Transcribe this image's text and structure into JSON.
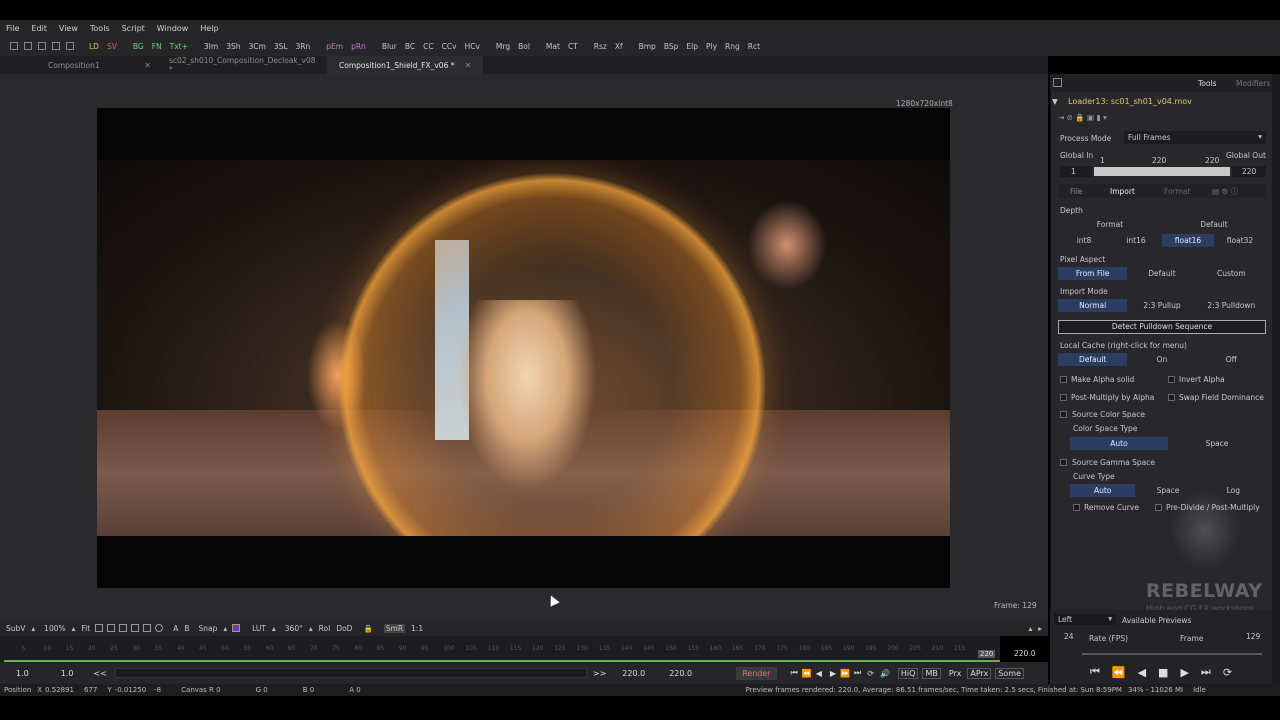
{
  "menu": [
    "File",
    "Edit",
    "View",
    "Tools",
    "Script",
    "Window",
    "Help"
  ],
  "toolbar": {
    "items": [
      {
        "label": "LD",
        "color": "yel"
      },
      {
        "label": "SV",
        "color": "red"
      },
      {
        "label": "BG",
        "color": "grn"
      },
      {
        "label": "FN",
        "color": "grn"
      },
      {
        "label": "Txt+",
        "color": "grn"
      },
      {
        "label": "3Im",
        "color": ""
      },
      {
        "label": "3Sh",
        "color": ""
      },
      {
        "label": "3Cm",
        "color": ""
      },
      {
        "label": "3SL",
        "color": ""
      },
      {
        "label": "3Rn",
        "color": ""
      },
      {
        "label": "pEm",
        "color": "pink"
      },
      {
        "label": "pRn",
        "color": "pink"
      },
      {
        "label": "Blur",
        "color": ""
      },
      {
        "label": "BC",
        "color": ""
      },
      {
        "label": "CC",
        "color": ""
      },
      {
        "label": "CCv",
        "color": ""
      },
      {
        "label": "HCv",
        "color": ""
      },
      {
        "label": "Mrg",
        "color": ""
      },
      {
        "label": "Bol",
        "color": ""
      },
      {
        "label": "Mat",
        "color": ""
      },
      {
        "label": "CT",
        "color": ""
      },
      {
        "label": "Rsz",
        "color": ""
      },
      {
        "label": "Xf",
        "color": ""
      },
      {
        "label": "Bmp",
        "color": ""
      },
      {
        "label": "BSp",
        "color": ""
      },
      {
        "label": "Elp",
        "color": ""
      },
      {
        "label": "Ply",
        "color": ""
      },
      {
        "label": "Rng",
        "color": ""
      },
      {
        "label": "Rct",
        "color": ""
      }
    ]
  },
  "tabs": [
    {
      "label": "Composition1",
      "active": false
    },
    {
      "label": "sc02_sh010_Composition_Decloak_v08 *",
      "active": false
    },
    {
      "label": "Composition1_Shield_FX_v06 *",
      "active": true
    }
  ],
  "viewer": {
    "resolution": "1280x720xint8",
    "frame_info": "Frame: 129"
  },
  "viewer_tools": [
    "SubV",
    "100%",
    "Fit",
    "Snap",
    "LUT",
    "360°",
    "RoI",
    "DoD",
    "SmR",
    "1:1"
  ],
  "ruler": {
    "ticks": [
      "5",
      "10",
      "15",
      "20",
      "25",
      "30",
      "35",
      "40",
      "45",
      "50",
      "55",
      "60",
      "65",
      "70",
      "75",
      "80",
      "85",
      "90",
      "95",
      "100",
      "105",
      "110",
      "115",
      "120",
      "125",
      "130",
      "135",
      "140",
      "145",
      "150",
      "155",
      "160",
      "165",
      "170",
      "175",
      "180",
      "185",
      "190",
      "195",
      "200",
      "205",
      "210",
      "215"
    ],
    "end_marker": "220",
    "end_value": "220.0"
  },
  "transport": {
    "left1": "1.0",
    "left2": "1.0",
    "prev": "<<",
    "next": ">>",
    "render_start": "220.0",
    "render_end": "220.0",
    "render_label": "Render",
    "btns": [
      "HiQ",
      "MB",
      "Prx",
      "APrx",
      "Some"
    ]
  },
  "status": {
    "position_label": "Position",
    "x_label": "X",
    "x_value": "0.52891",
    "x_px": "677",
    "y_label": "Y",
    "y_value": "-0.01250",
    "y_px": "-8",
    "canvas": "Canvas R 0",
    "g": "G 0",
    "b": "B 0",
    "a": "A 0",
    "message": "Preview frames rendered: 220.0, Average: 86.51 frames/sec, Time taken: 2.5 secs, Finished at: Sun 8:59PM",
    "memory": "34% - 11026 MI",
    "state": "Idle"
  },
  "panel": {
    "tab_tools": "Tools",
    "tab_modifiers": "Modifiers",
    "node_title": "Loader13: sc01_sh01_v04.mov",
    "process_mode_label": "Process Mode",
    "process_mode_value": "Full Frames",
    "global_in_label": "Global In",
    "global_out_label": "Global Out",
    "global_in_value": "1",
    "global_out_value": "220",
    "range_start": "1",
    "range_mid": "220",
    "range_end": "220",
    "subtabs": [
      "File",
      "Import",
      "Format"
    ],
    "depth_label": "Depth",
    "depth_row1": [
      "Format",
      "Default"
    ],
    "depth_row2": [
      "int8",
      "int16",
      "float16",
      "float32"
    ],
    "pixel_aspect_label": "Pixel Aspect",
    "pixel_aspect": [
      "From File",
      "Default",
      "Custom"
    ],
    "import_mode_label": "Import Mode",
    "import_mode": [
      "Normal",
      "2:3 Pullup",
      "2:3 Pulldown"
    ],
    "detect_btn": "Detect Pulldown Sequence",
    "local_cache_label": "Local Cache (right-click for menu)",
    "local_cache": [
      "Default",
      "On",
      "Off"
    ],
    "make_alpha_solid": "Make Alpha solid",
    "invert_alpha": "Invert Alpha",
    "post_multiply": "Post-Multiply by Alpha",
    "swap_field": "Swap Field Dominance",
    "source_color_space": "Source Color Space",
    "color_space_type": "Color Space Type",
    "color_space_opts": [
      "Auto",
      "Space"
    ],
    "source_gamma_space": "Source Gamma Space",
    "curve_type": "Curve Type",
    "curve_opts": [
      "Auto",
      "Space",
      "Log"
    ],
    "remove_curve": "Remove Curve",
    "pre_divide": "Pre-Divide / Post-Multiply",
    "left_select": "Left",
    "available_previews": "Available Previews",
    "fps_value": "24",
    "rate_label": "Rate (FPS)",
    "frame_label": "Frame",
    "frame_value": "129"
  },
  "watermark": {
    "brand": "REBELWAY",
    "tagline": "High end CG FX workshops"
  },
  "colors": {
    "accent_blue": "#2c3d63",
    "timeline_green": "#6ab04c",
    "title_yellow": "#e0c96a"
  }
}
